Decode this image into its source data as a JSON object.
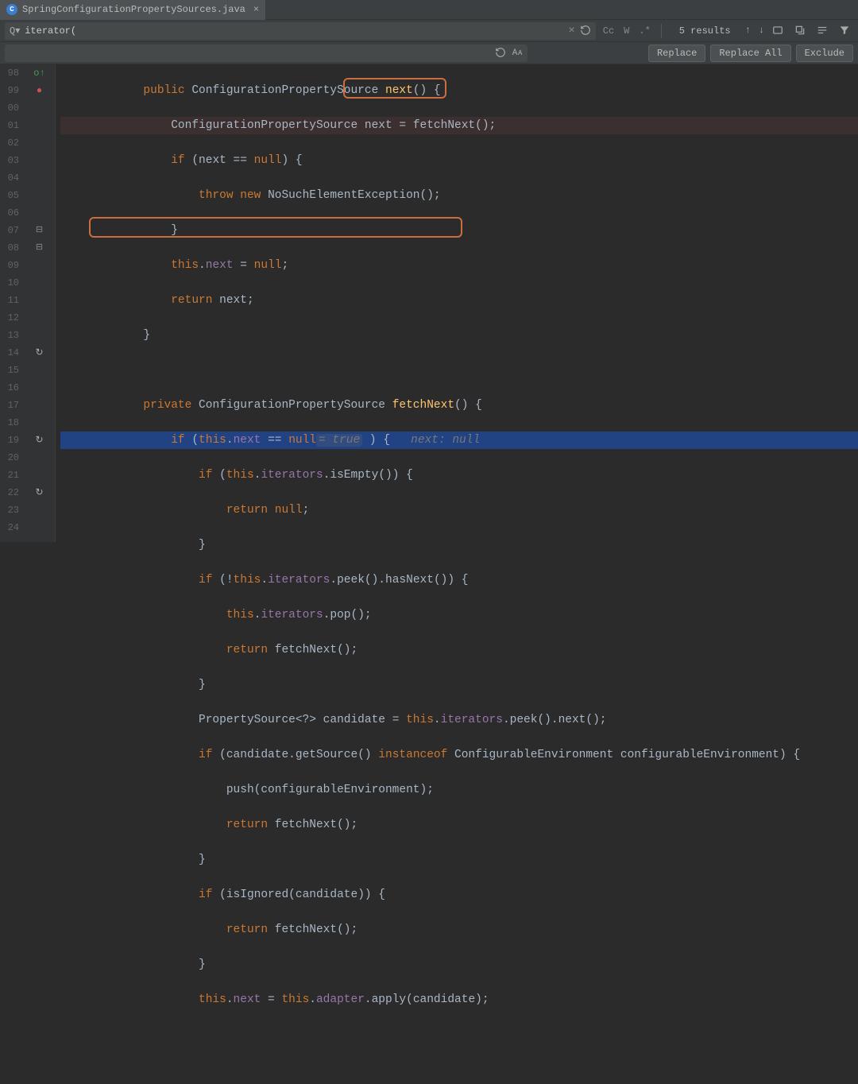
{
  "tab": {
    "filename": "SpringConfigurationPropertySources.java",
    "icon_letter": "C"
  },
  "find": {
    "query": "iterator(",
    "results": "5 results",
    "cc": "Cc",
    "w": "W",
    "regex": ".*"
  },
  "replace": {
    "replace_btn": "Replace",
    "replace_all_btn": "Replace All",
    "exclude_btn": "Exclude",
    "aa": "Aᴀ"
  },
  "lines": {
    "l98": "public",
    "l98_type": "ConfigurationPropertySource",
    "l98_method": "next",
    "l99_type": "ConfigurationPropertySource",
    "l99_var": "next",
    "l99_call": "fetchNext();",
    "l100_if": "if",
    "l100_cond": "(next == ",
    "l100_null": "null",
    "l100_brace": ") {",
    "l101_throw": "throw new",
    "l101_excl": "NoSuchElementException",
    "l102_brace": "}",
    "l103_this": "this",
    "l103_field": "next",
    "l103_assign": " = ",
    "l103_null": "null",
    "l104_return": "return",
    "l104_var": " next;",
    "l105_brace": "}",
    "l107_private": "private",
    "l107_type": "ConfigurationPropertySource",
    "l107_method": "fetchNext",
    "l108_if": "if",
    "l108_this": "this",
    "l108_next": "next",
    "l108_null": "null",
    "l108_hint_eq": "= true",
    "l108_hint_param": "next: null",
    "l109_if": "if",
    "l109_this": "this",
    "l109_iters": "iterators",
    "l109_isEmpty": "isEmpty",
    "l110_return": "return null",
    "l111_brace": "}",
    "l112_if": "if",
    "l112_this": "this",
    "l112_iters": "iterators",
    "l112_peek": "peek",
    "l112_hasNext": "hasNext",
    "l113_this": "this",
    "l113_iters": "iterators",
    "l113_pop": "pop",
    "l114_return": "return",
    "l114_fetch": "fetchNext",
    "l115_brace": "}",
    "l116_type": "PropertySource<?>",
    "l116_var": "candidate",
    "l116_this": "this",
    "l116_iters": "iterators",
    "l116_peek": "peek",
    "l116_next": "next",
    "l117_if": "if",
    "l117_cand": "candidate",
    "l117_getSource": "getSource",
    "l117_instanceof": "instanceof",
    "l117_ce": "ConfigurableEnvironment",
    "l117_cevar": "configurableEnvironment",
    "l118_push": "push",
    "l118_arg": "configurableEnvironment",
    "l119_return": "return",
    "l119_fetch": "fetchNext",
    "l120_brace": "}",
    "l121_if": "if",
    "l121_isIgnored": "isIgnored",
    "l121_cand": "candidate",
    "l122_return": "return",
    "l122_fetch": "fetchNext",
    "l123_brace": "}",
    "l124_this": "this",
    "l124_next": "next",
    "l124_this2": "this",
    "l124_adapter": "adapter",
    "l124_apply": "apply",
    "l124_cand": "candidate"
  },
  "line_numbers": [
    "98",
    "99",
    "00",
    "01",
    "02",
    "03",
    "04",
    "05",
    "06",
    "07",
    "08",
    "09",
    "10",
    "11",
    "12",
    "13",
    "14",
    "15",
    "16",
    "17",
    "18",
    "19",
    "20",
    "21",
    "22",
    "23",
    "24"
  ]
}
